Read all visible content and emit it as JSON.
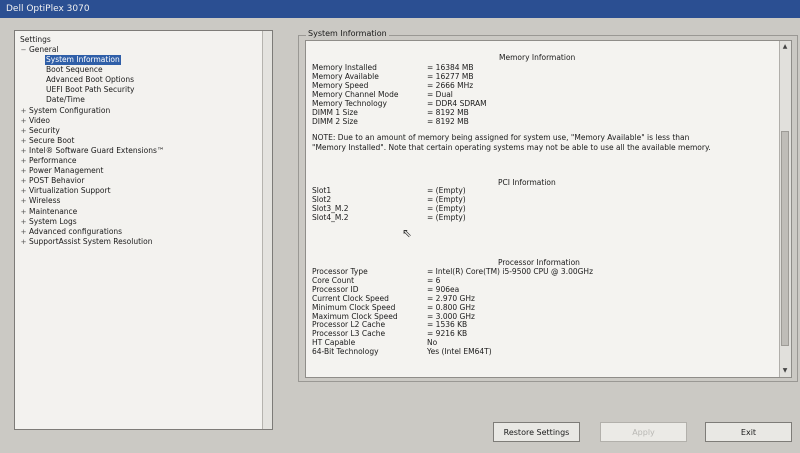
{
  "window": {
    "title": "Dell OptiPlex 3070"
  },
  "tree": {
    "root_label": "Settings",
    "items": [
      {
        "label": "General",
        "level": 0,
        "expander": "−"
      },
      {
        "label": "System Information",
        "level": 1,
        "selected": true
      },
      {
        "label": "Boot Sequence",
        "level": 1
      },
      {
        "label": "Advanced Boot Options",
        "level": 1
      },
      {
        "label": "UEFI Boot Path Security",
        "level": 1
      },
      {
        "label": "Date/Time",
        "level": 1
      },
      {
        "label": "System Configuration",
        "level": 0,
        "expander": "+"
      },
      {
        "label": "Video",
        "level": 0,
        "expander": "+"
      },
      {
        "label": "Security",
        "level": 0,
        "expander": "+"
      },
      {
        "label": "Secure Boot",
        "level": 0,
        "expander": "+"
      },
      {
        "label": "Intel® Software Guard Extensions™",
        "level": 0,
        "expander": "+"
      },
      {
        "label": "Performance",
        "level": 0,
        "expander": "+"
      },
      {
        "label": "Power Management",
        "level": 0,
        "expander": "+"
      },
      {
        "label": "POST Behavior",
        "level": 0,
        "expander": "+"
      },
      {
        "label": "Virtualization Support",
        "level": 0,
        "expander": "+"
      },
      {
        "label": "Wireless",
        "level": 0,
        "expander": "+"
      },
      {
        "label": "Maintenance",
        "level": 0,
        "expander": "+"
      },
      {
        "label": "System Logs",
        "level": 0,
        "expander": "+"
      },
      {
        "label": "Advanced configurations",
        "level": 0,
        "expander": "+"
      },
      {
        "label": "SupportAssist System Resolution",
        "level": 0,
        "expander": "+"
      }
    ]
  },
  "info": {
    "group_title": "System Information",
    "memory": {
      "heading": "Memory Information",
      "rows": [
        {
          "k": "Memory Installed",
          "v": "= 16384 MB"
        },
        {
          "k": "Memory Available",
          "v": "= 16277 MB"
        },
        {
          "k": "Memory Speed",
          "v": "= 2666 MHz"
        },
        {
          "k": "Memory Channel Mode",
          "v": "= Dual"
        },
        {
          "k": "Memory Technology",
          "v": "= DDR4 SDRAM"
        },
        {
          "k": "DIMM 1 Size",
          "v": "= 8192 MB"
        },
        {
          "k": "DIMM 2 Size",
          "v": "= 8192 MB"
        }
      ],
      "note": "NOTE: Due to an amount of memory being assigned for system use, \"Memory Available\" is less than \"Memory Installed\". Note that certain operating systems may not be able to use all the available memory."
    },
    "pci": {
      "heading": "PCI Information",
      "rows": [
        {
          "k": "Slot1",
          "v": "= (Empty)"
        },
        {
          "k": "Slot2",
          "v": "= (Empty)"
        },
        {
          "k": "Slot3_M.2",
          "v": "= (Empty)"
        },
        {
          "k": "Slot4_M.2",
          "v": "= (Empty)"
        }
      ]
    },
    "processor": {
      "heading": "Processor Information",
      "rows": [
        {
          "k": "Processor Type",
          "v": "= Intel(R) Core(TM) i5-9500 CPU @ 3.00GHz"
        },
        {
          "k": "Core Count",
          "v": "= 6"
        },
        {
          "k": "Processor ID",
          "v": "= 906ea"
        },
        {
          "k": "Current Clock Speed",
          "v": "= 2.970 GHz"
        },
        {
          "k": "Minimum Clock Speed",
          "v": "= 0.800 GHz"
        },
        {
          "k": "Maximum Clock Speed",
          "v": "= 3.000 GHz"
        },
        {
          "k": "Processor L2 Cache",
          "v": "= 1536 KB"
        },
        {
          "k": "Processor L3 Cache",
          "v": "= 9216 KB"
        },
        {
          "k": "HT Capable",
          "v": "No"
        },
        {
          "k": "64-Bit Technology",
          "v": "Yes (Intel EM64T)"
        }
      ]
    }
  },
  "buttons": {
    "restore": "Restore Settings",
    "apply": "Apply",
    "exit": "Exit"
  }
}
